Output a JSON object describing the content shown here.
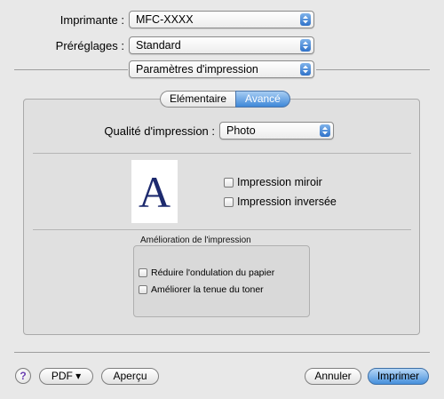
{
  "printer": {
    "label": "Imprimante :",
    "value": "MFC-XXXX"
  },
  "presets": {
    "label": "Préréglages :",
    "value": "Standard"
  },
  "section_popup": {
    "value": "Paramètres d'impression"
  },
  "tabs": [
    {
      "label": "Elémentaire",
      "selected": false
    },
    {
      "label": "Avancé",
      "selected": true
    }
  ],
  "quality": {
    "label": "Qualité d'impression :",
    "value": "Photo"
  },
  "preview_letter": "A",
  "options": {
    "mirror": {
      "label": "Impression miroir",
      "checked": false
    },
    "reverse": {
      "label": "Impression inversée",
      "checked": false
    }
  },
  "improvement": {
    "title": "Amélioration de l'impression",
    "items": [
      {
        "label": "Réduire l'ondulation du papier",
        "checked": false
      },
      {
        "label": "Améliorer la tenue du toner",
        "checked": false
      }
    ]
  },
  "footer": {
    "help_symbol": "?",
    "pdf_label": "PDF ▾",
    "preview_label": "Aperçu",
    "cancel_label": "Annuler",
    "print_label": "Imprimer"
  },
  "colors": {
    "accent": "#3f88d8",
    "preview_letter": "#1d2a6e"
  }
}
